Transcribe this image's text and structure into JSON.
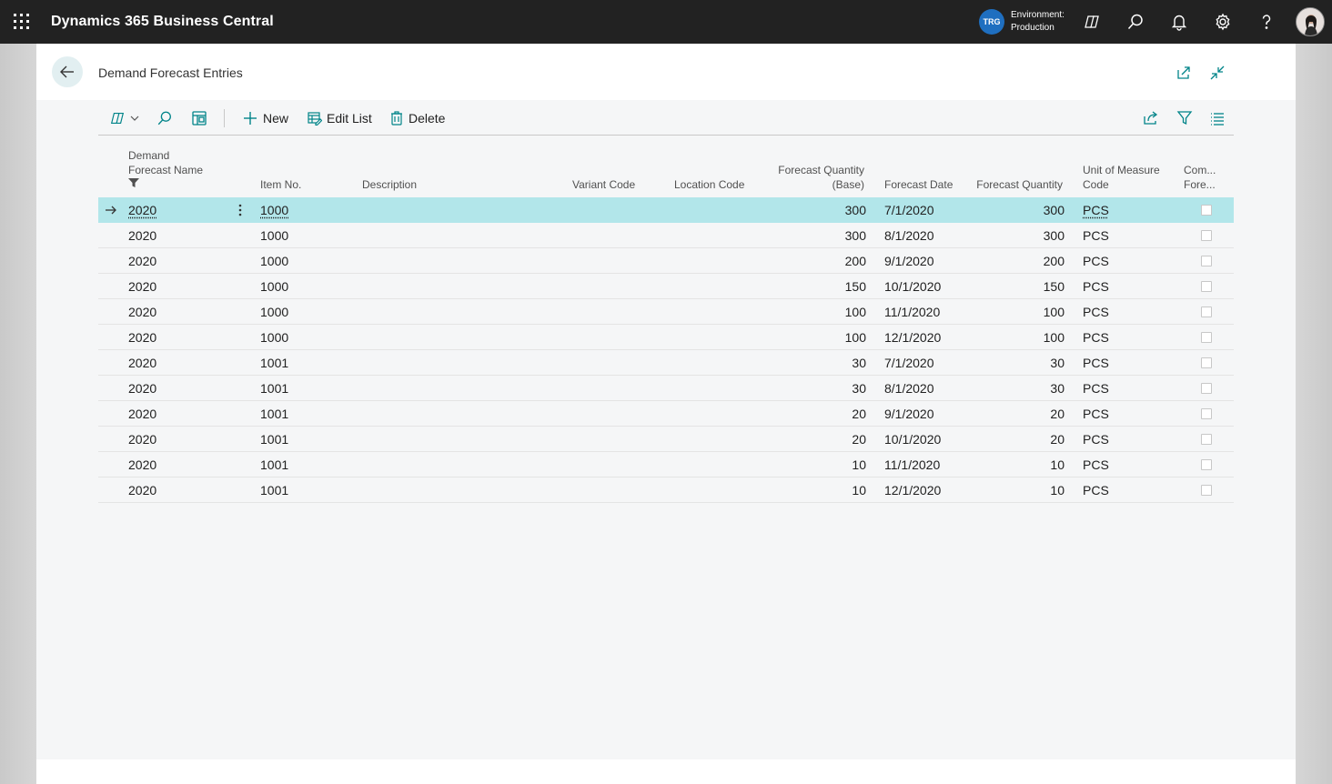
{
  "topbar": {
    "app_title": "Dynamics 365 Business Central",
    "env_badge": "TRG",
    "env_label": "Environment:",
    "env_name": "Production"
  },
  "page": {
    "title": "Demand Forecast Entries"
  },
  "actions": {
    "new_label": "New",
    "edit_list_label": "Edit List",
    "delete_label": "Delete"
  },
  "columns": {
    "forecast_name_line1": "Demand",
    "forecast_name_line2": "Forecast Name",
    "item_no": "Item No.",
    "description": "Description",
    "variant_code": "Variant Code",
    "location_code": "Location Code",
    "qty_base_line1": "Forecast Quantity",
    "qty_base_line2": "(Base)",
    "forecast_date": "Forecast Date",
    "forecast_qty": "Forecast Quantity",
    "uom_line1": "Unit of Measure",
    "uom_line2": "Code",
    "comp_line1": "Com...",
    "comp_line2": "Fore..."
  },
  "rows": [
    {
      "name": "2020",
      "item": "1000",
      "qty_base": "300",
      "date": "7/1/2020",
      "qty": "300",
      "uom": "PCS"
    },
    {
      "name": "2020",
      "item": "1000",
      "qty_base": "300",
      "date": "8/1/2020",
      "qty": "300",
      "uom": "PCS"
    },
    {
      "name": "2020",
      "item": "1000",
      "qty_base": "200",
      "date": "9/1/2020",
      "qty": "200",
      "uom": "PCS"
    },
    {
      "name": "2020",
      "item": "1000",
      "qty_base": "150",
      "date": "10/1/2020",
      "qty": "150",
      "uom": "PCS"
    },
    {
      "name": "2020",
      "item": "1000",
      "qty_base": "100",
      "date": "11/1/2020",
      "qty": "100",
      "uom": "PCS"
    },
    {
      "name": "2020",
      "item": "1000",
      "qty_base": "100",
      "date": "12/1/2020",
      "qty": "100",
      "uom": "PCS"
    },
    {
      "name": "2020",
      "item": "1001",
      "qty_base": "30",
      "date": "7/1/2020",
      "qty": "30",
      "uom": "PCS"
    },
    {
      "name": "2020",
      "item": "1001",
      "qty_base": "30",
      "date": "8/1/2020",
      "qty": "30",
      "uom": "PCS"
    },
    {
      "name": "2020",
      "item": "1001",
      "qty_base": "20",
      "date": "9/1/2020",
      "qty": "20",
      "uom": "PCS"
    },
    {
      "name": "2020",
      "item": "1001",
      "qty_base": "20",
      "date": "10/1/2020",
      "qty": "20",
      "uom": "PCS"
    },
    {
      "name": "2020",
      "item": "1001",
      "qty_base": "10",
      "date": "11/1/2020",
      "qty": "10",
      "uom": "PCS"
    },
    {
      "name": "2020",
      "item": "1001",
      "qty_base": "10",
      "date": "12/1/2020",
      "qty": "10",
      "uom": "PCS"
    }
  ],
  "colors": {
    "topbar": "#222222",
    "accent": "#008489",
    "selected_row": "#b2e6ea",
    "env_badge": "#1f6fc0"
  }
}
